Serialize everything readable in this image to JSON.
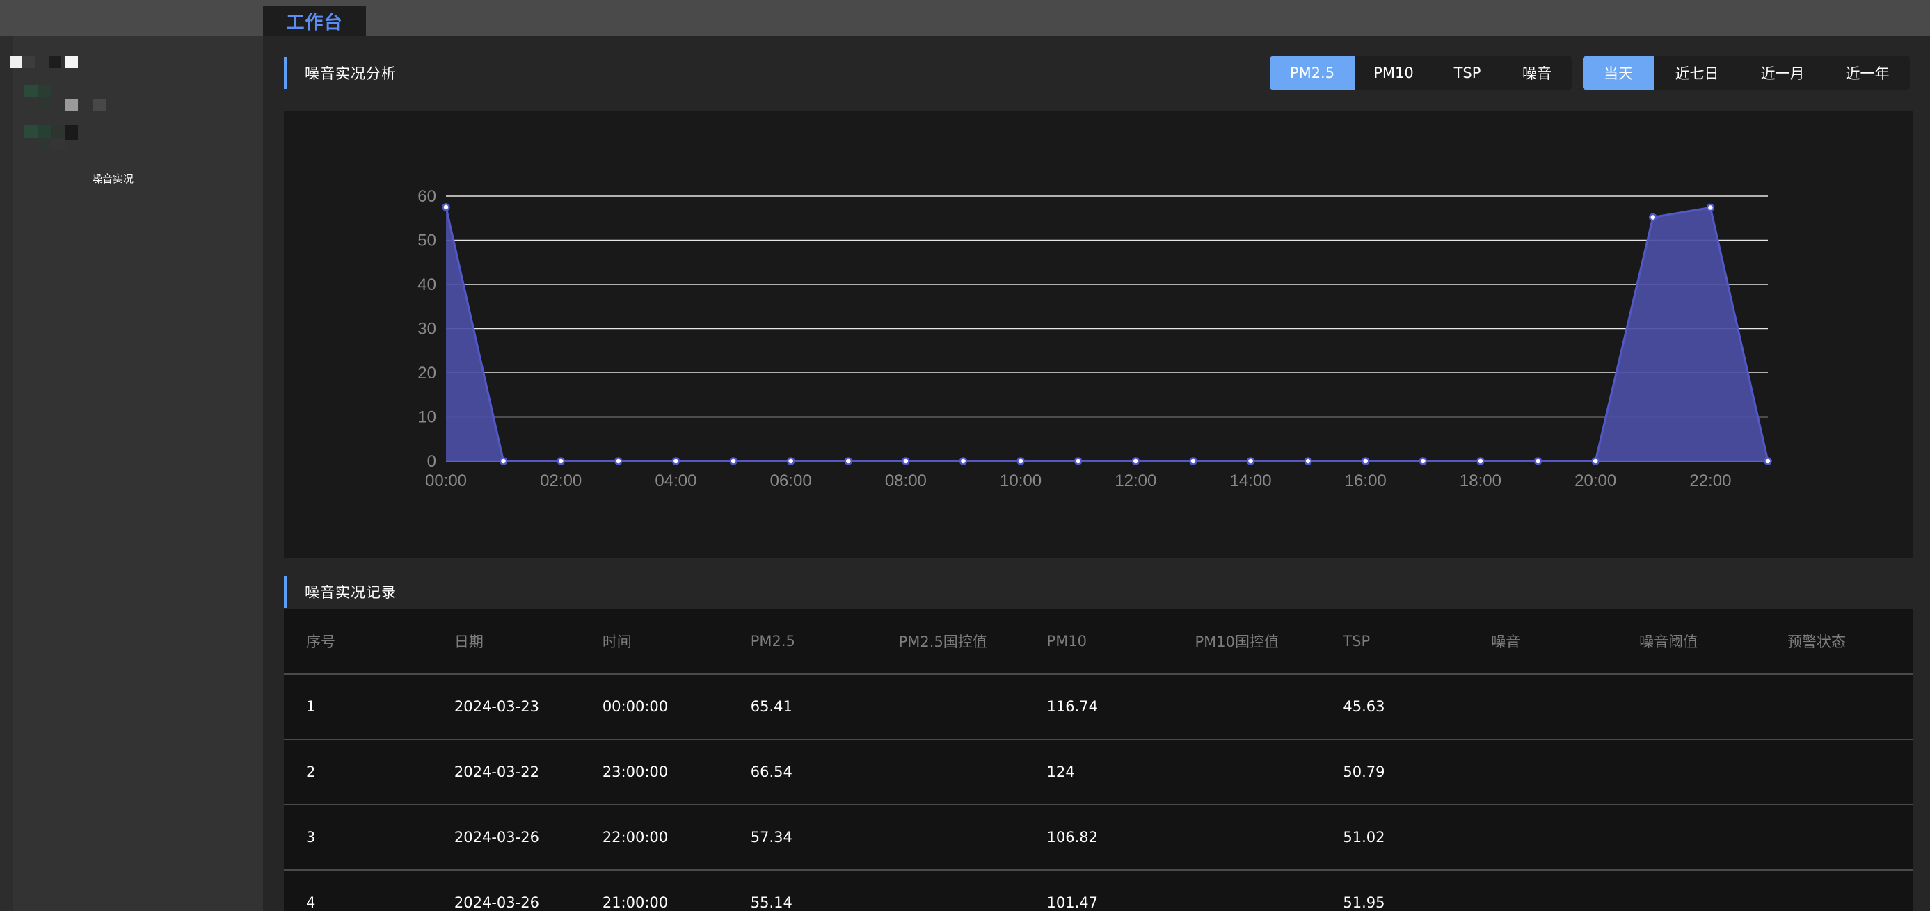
{
  "app": {
    "tab_label": "工作台"
  },
  "sidebar": {
    "menu_item_label": "噪音实况"
  },
  "analysis": {
    "title": "噪音实况分析",
    "metric_tabs": [
      {
        "label": "PM2.5",
        "active": true
      },
      {
        "label": "PM10",
        "active": false
      },
      {
        "label": "TSP",
        "active": false
      },
      {
        "label": "噪音",
        "active": false
      }
    ],
    "range_tabs": [
      {
        "label": "当天",
        "active": true
      },
      {
        "label": "近七日",
        "active": false
      },
      {
        "label": "近一月",
        "active": false
      },
      {
        "label": "近一年",
        "active": false
      }
    ]
  },
  "chart_data": {
    "type": "area",
    "x": [
      "00:00",
      "01:00",
      "02:00",
      "03:00",
      "04:00",
      "05:00",
      "06:00",
      "07:00",
      "08:00",
      "09:00",
      "10:00",
      "11:00",
      "12:00",
      "13:00",
      "14:00",
      "15:00",
      "16:00",
      "17:00",
      "18:00",
      "19:00",
      "20:00",
      "21:00",
      "22:00",
      "23:00"
    ],
    "x_tick_labels": [
      "00:00",
      "02:00",
      "04:00",
      "06:00",
      "08:00",
      "10:00",
      "12:00",
      "14:00",
      "16:00",
      "18:00",
      "20:00",
      "22:00"
    ],
    "values": [
      57.5,
      0,
      0,
      0,
      0,
      0,
      0,
      0,
      0,
      0,
      0,
      0,
      0,
      0,
      0,
      0,
      0,
      0,
      0,
      0,
      0,
      55.2,
      57.4,
      0
    ],
    "y_ticks": [
      0,
      10,
      20,
      30,
      40,
      50,
      60
    ],
    "ylim": [
      0,
      60
    ],
    "grid": true,
    "title": "",
    "xlabel": "",
    "ylabel": "",
    "color": "#5259c7",
    "fill": "#4a4ea3"
  },
  "records": {
    "title": "噪音实况记录",
    "columns": [
      "序号",
      "日期",
      "时间",
      "PM2.5",
      "PM2.5国控值",
      "PM10",
      "PM10国控值",
      "TSP",
      "噪音",
      "噪音阈值",
      "预警状态"
    ],
    "rows": [
      [
        "1",
        "2024-03-23",
        "00:00:00",
        "65.41",
        "",
        "116.74",
        "",
        "45.63",
        "",
        "",
        ""
      ],
      [
        "2",
        "2024-03-22",
        "23:00:00",
        "66.54",
        "",
        "124",
        "",
        "50.79",
        "",
        "",
        ""
      ],
      [
        "3",
        "2024-03-26",
        "22:00:00",
        "57.34",
        "",
        "106.82",
        "",
        "51.02",
        "",
        "",
        ""
      ],
      [
        "4",
        "2024-03-26",
        "21:00:00",
        "55.14",
        "",
        "101.47",
        "",
        "51.95",
        "",
        "",
        ""
      ]
    ]
  },
  "colors": {
    "accent": "#6ba7f5",
    "tab_text": "#5b8ef5",
    "section_bar": "#5d9ef7"
  }
}
